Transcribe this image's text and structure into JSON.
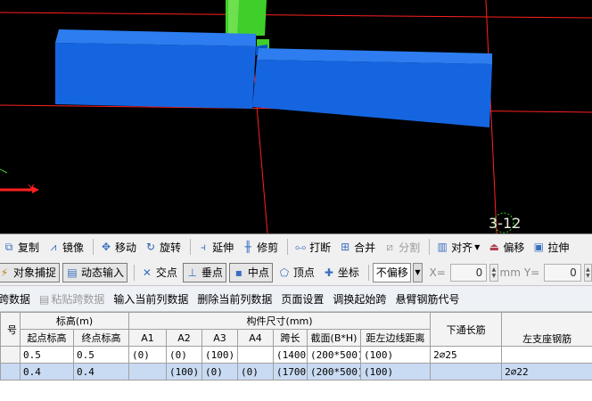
{
  "viewport": {
    "grid_label": "3-12"
  },
  "toolbar1": {
    "items": [
      {
        "label": "复制",
        "icon": "copy-icon",
        "glyph": "⧉",
        "enabled": true
      },
      {
        "label": "镜像",
        "icon": "mirror-icon",
        "glyph": "⩘",
        "enabled": true
      },
      {
        "label": "移动",
        "icon": "move-icon",
        "glyph": "✥",
        "enabled": true
      },
      {
        "label": "旋转",
        "icon": "rotate-icon",
        "glyph": "↻",
        "enabled": true
      },
      {
        "label": "延伸",
        "icon": "extend-icon",
        "glyph": "⫞",
        "enabled": true
      },
      {
        "label": "修剪",
        "icon": "trim-icon",
        "glyph": "╫",
        "enabled": true
      },
      {
        "label": "打断",
        "icon": "break-icon",
        "glyph": "⧟",
        "enabled": true
      },
      {
        "label": "合并",
        "icon": "merge-icon",
        "glyph": "⊞",
        "enabled": true
      },
      {
        "label": "分割",
        "icon": "split-icon",
        "glyph": "⧄",
        "enabled": false
      },
      {
        "label": "对齐",
        "icon": "align-icon",
        "glyph": "▥",
        "enabled": true
      },
      {
        "label": "偏移",
        "icon": "offset-icon",
        "glyph": "⏏",
        "enabled": true
      },
      {
        "label": "拉伸",
        "icon": "stretch-icon",
        "glyph": "▣",
        "enabled": true
      }
    ]
  },
  "toolbar2": {
    "object_snap": "对象捕捉",
    "dynamic_input": "动态输入",
    "intersection": "交点",
    "perpendicular": "垂点",
    "midpoint": "中点",
    "vertex": "顶点",
    "coordinate": "坐标",
    "offset_mode": "不偏移",
    "x_label": "X=",
    "x_value": "0",
    "unit": "mm",
    "y_label": "Y=",
    "y_value": "0"
  },
  "toolbar3": {
    "links": [
      "跨数据",
      "粘贴跨数据",
      "输入当前列数据",
      "删除当前列数据",
      "页面设置",
      "调换起始跨",
      "悬臂钢筋代号"
    ]
  },
  "table": {
    "header_top": {
      "index": "号",
      "elevation": "标高(m)",
      "dimensions": "构件尺寸(mm)",
      "through_bar": "下通长筋",
      "left_support": "左支座钢筋"
    },
    "header_sub": [
      "起点标高",
      "终点标高",
      "A1",
      "A2",
      "A3",
      "A4",
      "跨长",
      "截面(B*H)",
      "距左边线距离"
    ],
    "rows": [
      {
        "cells": [
          "0.5",
          "0.5",
          "(0)",
          "(0)",
          "(100)",
          "",
          "(1400)",
          "(200*500)",
          "(100)",
          "2⌀25",
          ""
        ],
        "selected": false
      },
      {
        "cells": [
          "0.4",
          "0.4",
          "",
          "(100)",
          "(0)",
          "(0)",
          "(1700)",
          "(200*500)",
          "(100)",
          "",
          "2⌀22"
        ],
        "selected": true
      }
    ]
  },
  "colors": {
    "viewport_bg": "#000000",
    "beam": "#1565e0",
    "column": "#3fcf2a",
    "axis_red": "#ff2020",
    "selection": "#c9dbf2"
  }
}
